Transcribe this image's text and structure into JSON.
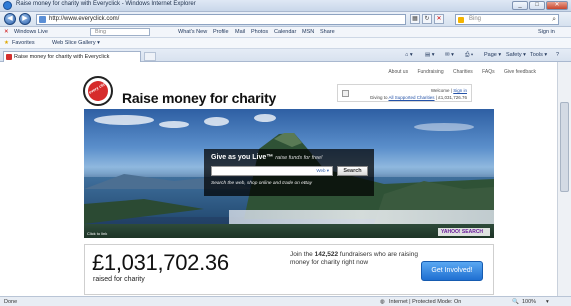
{
  "browser": {
    "title": "Raise money for charity with Everyclick - Windows Internet Explorer",
    "address": "http://www.everyclick.com/",
    "search_placeholder": "Bing",
    "live_bar": {
      "items": [
        "Windows Live",
        "Bing",
        "What's New",
        "Profile",
        "Mail",
        "Photos",
        "Calendar",
        "MSN",
        "Share",
        "Sign in"
      ]
    },
    "favorites": {
      "label": "Favorites",
      "web_slice": "Web Slice Gallery ▾"
    },
    "tab_title": "Raise money for charity with Everyclick",
    "command_bar": [
      "Page ▾",
      "Safety ▾",
      "Tools ▾"
    ],
    "status": {
      "left": "Done",
      "zone": "Internet | Protected Mode: On",
      "zoom": "100%"
    }
  },
  "site": {
    "nav": [
      "About us",
      "Fundraising",
      "Charities",
      "FAQs",
      "Give feedback"
    ],
    "logo_badge": "every click",
    "tagline": "Raise money for charity",
    "welcome": {
      "line1_prefix": "Welcome |",
      "sign_in": "Sign in",
      "line2_prefix": "Giving to",
      "line2_link": "All Supported Charities",
      "line2_suffix": "| £1,031,726.76"
    },
    "hero": {
      "title_bold": "Give as you Live",
      "title_tm": "™",
      "title_rest": "raise funds for free!",
      "input_hint": "Web ▾",
      "button": "Search",
      "subtitle": "Search the web, shop online and trade on eBay",
      "caption": "Click to link",
      "yahoo": "YAHOO! SEARCH"
    },
    "stats": {
      "amount": "£1,031,702.36",
      "raised_label": "raised for charity",
      "join_prefix": "Join the",
      "fundraisers": "142,522",
      "join_suffix": "fundraisers who are raising money for charity right now",
      "cta": "Get Involved!"
    }
  },
  "colors": {
    "brand_red": "#d62b2b",
    "cta_blue": "#1f6fd1",
    "link": "#2553a8"
  }
}
